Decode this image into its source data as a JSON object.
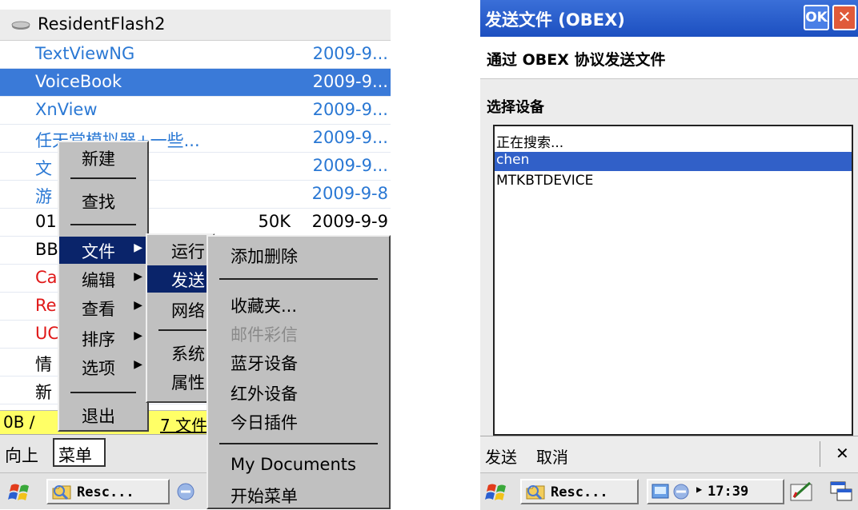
{
  "left": {
    "header_title": "ResidentFlash2",
    "files": [
      {
        "name": "TextViewNG",
        "size": "",
        "date": "2009-9...",
        "color": "blue",
        "selected": false
      },
      {
        "name": "VoiceBook",
        "size": "",
        "date": "2009-9...",
        "color": "blue",
        "selected": true
      },
      {
        "name": "XnView",
        "size": "",
        "date": "2009-9...",
        "color": "blue",
        "selected": false
      },
      {
        "name": "任天堂模拟器+一些...",
        "size": "",
        "date": "2009-9...",
        "color": "blue",
        "selected": false
      },
      {
        "name": "文",
        "size": "",
        "date": "2009-9...",
        "color": "blue",
        "selected": false
      },
      {
        "name": "游",
        "size": "",
        "date": "2009-9-8",
        "color": "blue",
        "selected": false
      },
      {
        "name": "01",
        "size": "50K",
        "date": "2009-9-9",
        "color": "black",
        "selected": false
      },
      {
        "name": "BB",
        "size": "",
        "date": "",
        "color": "black",
        "selected": false
      },
      {
        "name": "Ca",
        "size": "",
        "date": "",
        "color": "red",
        "selected": false
      },
      {
        "name": "Re",
        "size": "",
        "date": "",
        "color": "red",
        "selected": false
      },
      {
        "name": "UC",
        "size": "",
        "date": "",
        "color": "red",
        "selected": false
      },
      {
        "name": "情",
        "size": "",
        "date": "",
        "color": "black",
        "selected": false
      },
      {
        "name": "新",
        "size": "",
        "date": "",
        "color": "black",
        "selected": false
      }
    ],
    "status_left": "0B /",
    "status_right": "7 文件,",
    "cmd_up": "向上",
    "cmd_menu": "菜单",
    "task_label": "Resc...",
    "menu1": {
      "new": "新建",
      "find": "查找",
      "file": "文件",
      "edit": "编辑",
      "view": "查看",
      "sort": "排序",
      "options": "选项",
      "exit": "退出"
    },
    "menu2": {
      "run": "运行",
      "send": "发送",
      "network": "网络",
      "system": "系统",
      "properties": "属性"
    },
    "menu3": {
      "add_remove": "添加删除",
      "favorites": "收藏夹...",
      "mail_mms": "邮件彩信",
      "bluetooth": "蓝牙设备",
      "infrared": "红外设备",
      "today_plugin": "今日插件",
      "my_documents": "My Documents",
      "start_menu": "开始菜单"
    }
  },
  "right": {
    "title": "发送文件 (OBEX)",
    "ok_label": "OK",
    "close_label": "✕",
    "subtitle": "通过 OBEX 协议发送文件",
    "device_label": "选择设备",
    "devices": [
      "正在搜索...",
      "chen",
      "MTKBTDEVICE"
    ],
    "selected_device": 1,
    "send": "发送",
    "cancel": "取消",
    "close_x": "✕",
    "task_label": "Resc...",
    "time": "17:39"
  }
}
